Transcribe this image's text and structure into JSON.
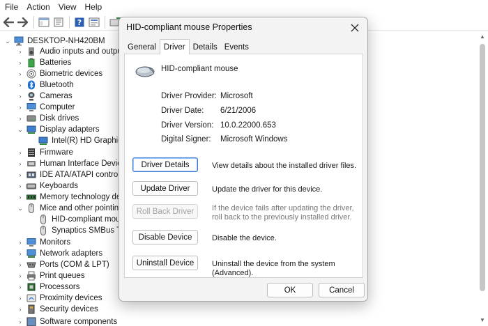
{
  "menubar": {
    "items": [
      "File",
      "Action",
      "View",
      "Help"
    ]
  },
  "toolbar": {
    "buttons": [
      "back-arrow-icon",
      "forward-arrow-icon",
      "show-hide-tree-icon",
      "properties-icon",
      "help-icon",
      "view-icon",
      "update-driver-icon"
    ]
  },
  "tree": {
    "root": "DESKTOP-NH420BM",
    "items": [
      {
        "label": "Audio inputs and outputs",
        "icon": "speaker-icon",
        "expanded": false
      },
      {
        "label": "Batteries",
        "icon": "battery-icon",
        "expanded": false
      },
      {
        "label": "Biometric devices",
        "icon": "fingerprint-icon",
        "expanded": false
      },
      {
        "label": "Bluetooth",
        "icon": "bluetooth-icon",
        "expanded": false
      },
      {
        "label": "Cameras",
        "icon": "camera-icon",
        "expanded": false
      },
      {
        "label": "Computer",
        "icon": "monitor-icon",
        "expanded": false
      },
      {
        "label": "Disk drives",
        "icon": "disk-icon",
        "expanded": false
      },
      {
        "label": "Display adapters",
        "icon": "display-adapter-icon",
        "expanded": true
      },
      {
        "label": "Intel(R) HD Graphics",
        "icon": "display-adapter-icon",
        "child": true
      },
      {
        "label": "Firmware",
        "icon": "chip-icon",
        "expanded": false
      },
      {
        "label": "Human Interface Devices",
        "icon": "hid-icon",
        "expanded": false
      },
      {
        "label": "IDE ATA/ATAPI controllers",
        "icon": "ide-icon",
        "expanded": false
      },
      {
        "label": "Keyboards",
        "icon": "keyboard-icon",
        "expanded": false
      },
      {
        "label": "Memory technology devices",
        "icon": "memory-icon",
        "expanded": false
      },
      {
        "label": "Mice and other pointing devices",
        "icon": "mouse-icon",
        "expanded": true
      },
      {
        "label": "HID-compliant mouse",
        "icon": "mouse-icon",
        "child": true,
        "selected": true
      },
      {
        "label": "Synaptics SMBus TouchPad",
        "icon": "mouse-icon",
        "child": true
      },
      {
        "label": "Monitors",
        "icon": "monitor-icon",
        "expanded": false
      },
      {
        "label": "Network adapters",
        "icon": "network-icon",
        "expanded": false
      },
      {
        "label": "Ports (COM & LPT)",
        "icon": "port-icon",
        "expanded": false
      },
      {
        "label": "Print queues",
        "icon": "printer-icon",
        "expanded": false
      },
      {
        "label": "Processors",
        "icon": "processor-icon",
        "expanded": false
      },
      {
        "label": "Proximity devices",
        "icon": "proximity-icon",
        "expanded": false
      },
      {
        "label": "Security devices",
        "icon": "security-icon",
        "expanded": false
      },
      {
        "label": "Software components",
        "icon": "software-icon",
        "expanded": false
      }
    ]
  },
  "dialog": {
    "title": "HID-compliant mouse Properties",
    "tabs": [
      "General",
      "Driver",
      "Details",
      "Events"
    ],
    "active_tab": "Driver",
    "device_name": "HID-compliant mouse",
    "info": {
      "provider_label": "Driver Provider:",
      "provider_value": "Microsoft",
      "date_label": "Driver Date:",
      "date_value": "6/21/2006",
      "version_label": "Driver Version:",
      "version_value": "10.0.22000.653",
      "signer_label": "Digital Signer:",
      "signer_value": "Microsoft Windows"
    },
    "actions": {
      "details_label": "Driver Details",
      "details_desc": "View details about the installed driver files.",
      "update_label": "Update Driver",
      "update_desc": "Update the driver for this device.",
      "rollback_label": "Roll Back Driver",
      "rollback_desc": "If the device fails after updating the driver, roll back to the previously installed driver.",
      "disable_label": "Disable Device",
      "disable_desc": "Disable the device.",
      "uninstall_label": "Uninstall Device",
      "uninstall_desc": "Uninstall the device from the system (Advanced)."
    },
    "ok_label": "OK",
    "cancel_label": "Cancel"
  },
  "colors": {
    "accent": "#3b7bd6",
    "dialog_bg": "#f3f3f3",
    "selected_row": "#cce4f7"
  }
}
